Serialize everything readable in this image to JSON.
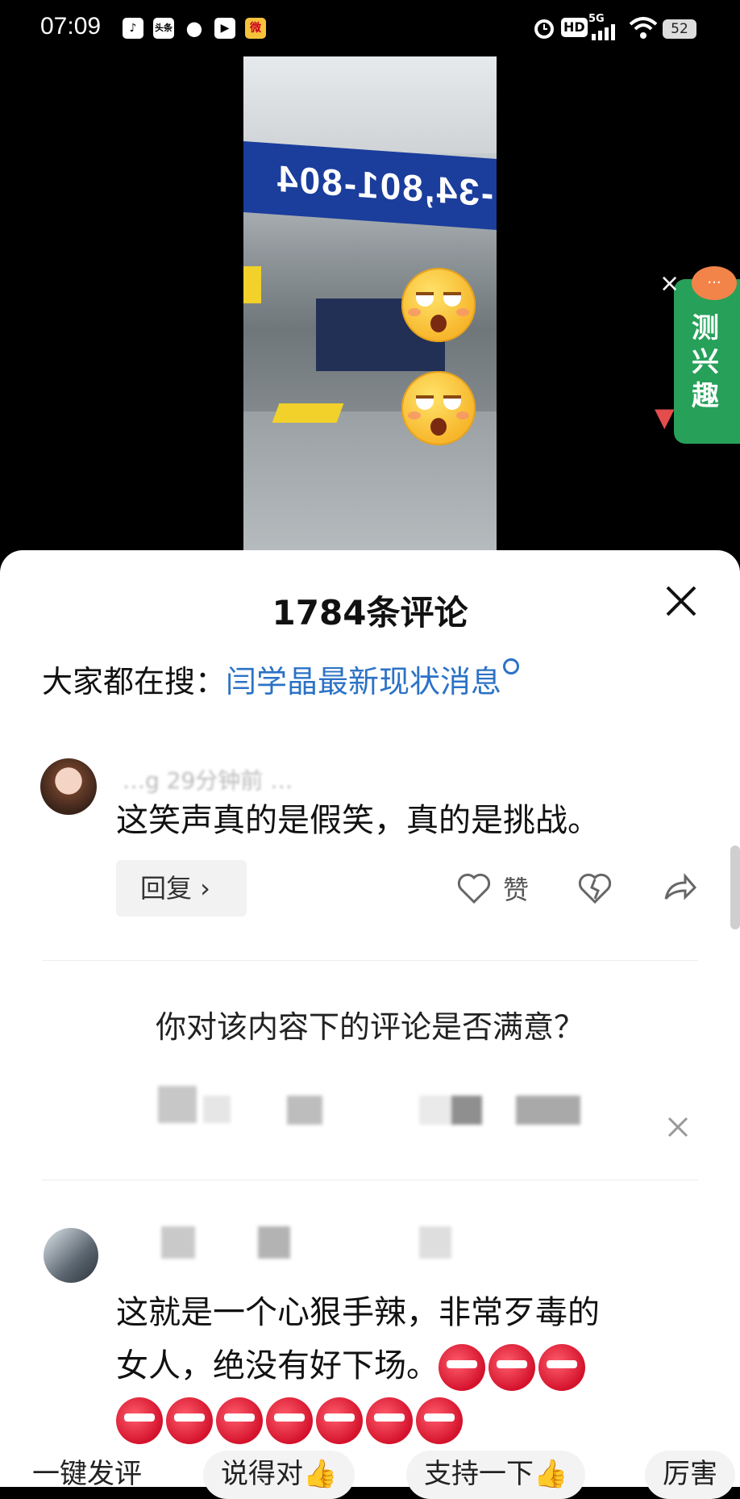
{
  "status_bar": {
    "time": "07:09",
    "battery": "52",
    "network": "5G",
    "hd": "HD",
    "app_icons": [
      "tiktok-icon",
      "toutiao-icon",
      "wechat-icon",
      "play-icon",
      "weibo-icon"
    ]
  },
  "video": {
    "sign_text": "-34,801-804"
  },
  "side_tab": {
    "label": "测兴趣",
    "close": "×"
  },
  "comments_panel": {
    "title": "1784条评论",
    "search_prefix": "大家都在搜：",
    "search_link": "闫学晶最新现状消息",
    "comments": [
      {
        "meta": "…g 29分钟前 …",
        "text": "这笑声真的是假笑，真的是挑战。",
        "reply_label": "回复 ›",
        "like_label": "赞"
      },
      {
        "meta": "",
        "text_line1": "这就是一个心狠手辣，非常歹毒的",
        "text_line2": "女人，绝没有好下场。"
      }
    ],
    "survey": {
      "question": "你对该内容下的评论是否满意？"
    },
    "bottom_bar": {
      "chips": [
        "一键发评",
        "说得对👍",
        "支持一下👍",
        "厉害"
      ]
    }
  },
  "colors": {
    "link": "#2b72c6",
    "side_tab": "#27a05a",
    "sign": "#1b3d9c"
  }
}
